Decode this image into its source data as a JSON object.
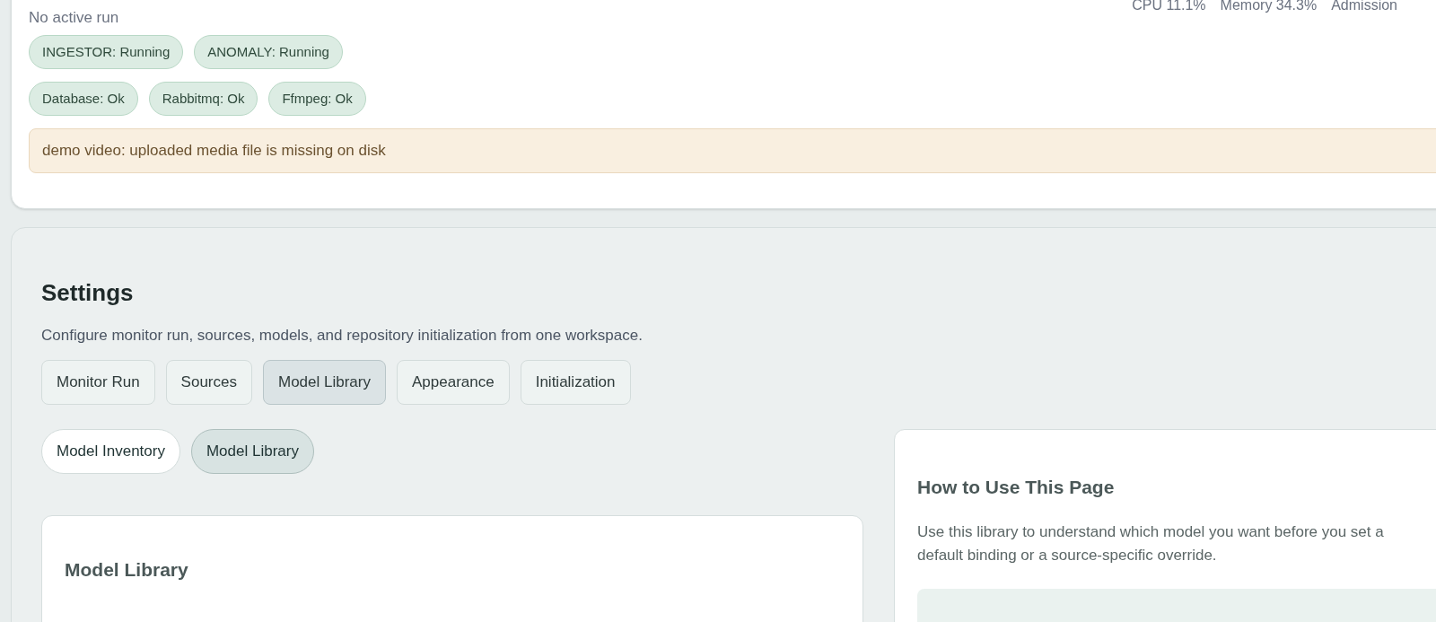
{
  "status_card": {
    "run_state": "No active run",
    "metrics": [
      "CPU 11.1%",
      "Memory 34.3%",
      "Admission"
    ],
    "services": [
      {
        "label": "INGESTOR: Running"
      },
      {
        "label": "ANOMALY: Running"
      }
    ],
    "dependencies": [
      {
        "label": "Database: Ok"
      },
      {
        "label": "Rabbitmq: Ok"
      },
      {
        "label": "Ffmpeg: Ok"
      }
    ],
    "warning": "demo video: uploaded media file is missing on disk"
  },
  "settings": {
    "title": "Settings",
    "description": "Configure monitor run, sources, models, and repository initialization from one workspace.",
    "tabs": [
      {
        "label": "Monitor Run",
        "selected": false
      },
      {
        "label": "Sources",
        "selected": false
      },
      {
        "label": "Model Library",
        "selected": true
      },
      {
        "label": "Appearance",
        "selected": false
      },
      {
        "label": "Initialization",
        "selected": false
      }
    ],
    "subtabs": [
      {
        "label": "Model Inventory",
        "selected": false
      },
      {
        "label": "Model Library",
        "selected": true
      }
    ],
    "library_card": {
      "title": "Model Library"
    },
    "help_card": {
      "title": "How to Use This Page",
      "text": "Use this library to understand which model you want before you set a default binding or a source-specific override."
    }
  }
}
